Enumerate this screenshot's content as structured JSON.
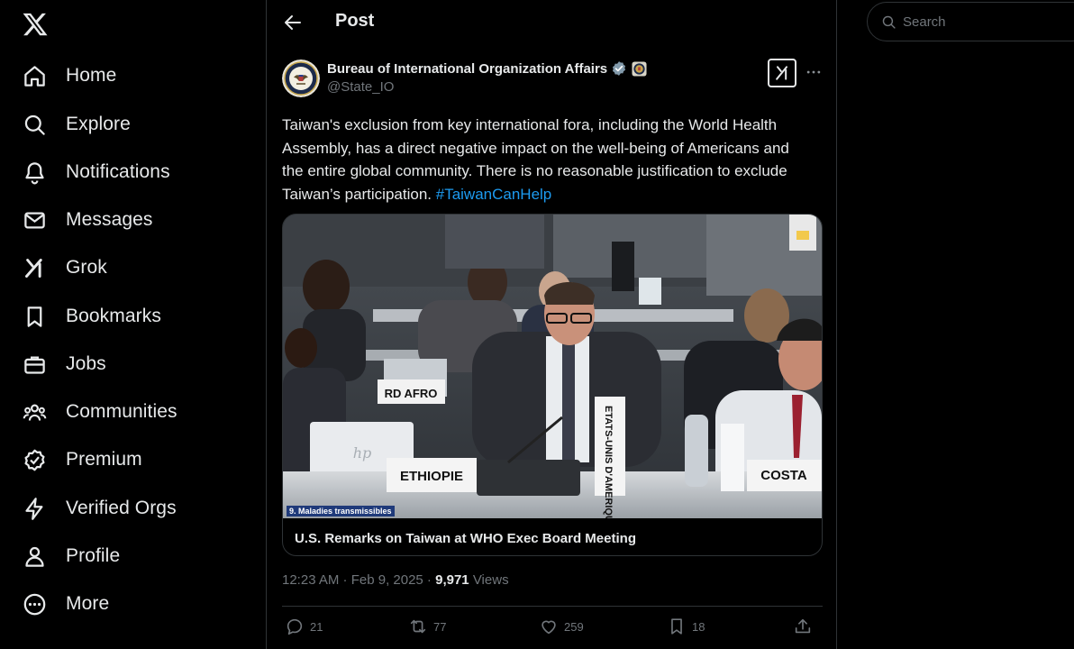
{
  "nav": {
    "items": [
      {
        "label": "Home",
        "icon": "home-icon"
      },
      {
        "label": "Explore",
        "icon": "search-icon"
      },
      {
        "label": "Notifications",
        "icon": "bell-icon"
      },
      {
        "label": "Messages",
        "icon": "envelope-icon"
      },
      {
        "label": "Grok",
        "icon": "grok-icon"
      },
      {
        "label": "Bookmarks",
        "icon": "bookmark-icon"
      },
      {
        "label": "Jobs",
        "icon": "briefcase-icon"
      },
      {
        "label": "Communities",
        "icon": "people-icon"
      },
      {
        "label": "Premium",
        "icon": "premium-icon"
      },
      {
        "label": "Verified Orgs",
        "icon": "lightning-icon"
      },
      {
        "label": "Profile",
        "icon": "person-icon"
      },
      {
        "label": "More",
        "icon": "more-circle-icon"
      }
    ]
  },
  "header": {
    "title": "Post"
  },
  "post": {
    "author_name": "Bureau of International Organization Affairs",
    "handle": "@State_IO",
    "text": "Taiwan's exclusion from key international fora, including the World Health Assembly, has a direct negative impact on the well-being of Americans and the entire global community. There is no reasonable justification to exclude Taiwan’s participation. ",
    "hashtag": "#TaiwanCanHelp",
    "card": {
      "caption": "U.S. Remarks on Taiwan at WHO Exec Board Meeting",
      "overlay_label": "9. Maladies transmissibles",
      "placards": [
        "RD AFRO",
        "ETHIOPIE",
        "ETATS-UNIS D'AMERIQUE",
        "COSTA"
      ]
    },
    "time": "12:23 AM · Feb 9, 2025 · ",
    "views_count": "9,971",
    "views_label": " Views",
    "stats": {
      "replies": "21",
      "reposts": "77",
      "likes": "259",
      "bookmarks": "18"
    }
  },
  "search": {
    "placeholder": "Search"
  },
  "colors": {
    "background": "#000000",
    "text": "#e7e9ea",
    "muted": "#71767b",
    "accent": "#1d9bf0",
    "border": "#2f3336"
  }
}
